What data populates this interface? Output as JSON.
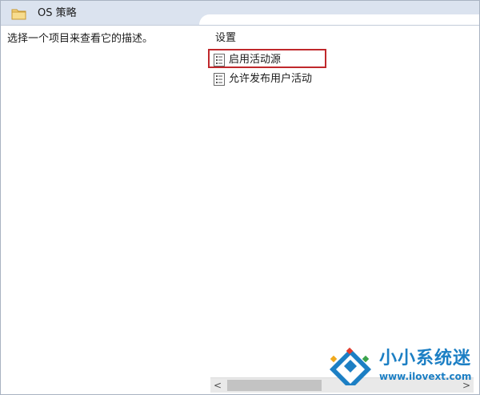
{
  "header": {
    "title": "OS 策略",
    "icon": "folder-icon"
  },
  "left_pane": {
    "description": "选择一个项目来查看它的描述。"
  },
  "right_pane": {
    "column_header": "设置",
    "items": [
      {
        "label": "启用活动源",
        "icon": "policy-setting-icon",
        "highlighted": true
      },
      {
        "label": "允许发布用户活动",
        "icon": "policy-setting-icon",
        "highlighted": false
      }
    ]
  },
  "scrollbar": {
    "left_arrow": "<",
    "right_arrow": ">"
  },
  "watermark": {
    "title": "小小系统迷",
    "url": "www.ilovext.com"
  },
  "colors": {
    "header_bg": "#dbe3ef",
    "highlight": "#c0282c",
    "watermark": "#1c7fc4"
  }
}
